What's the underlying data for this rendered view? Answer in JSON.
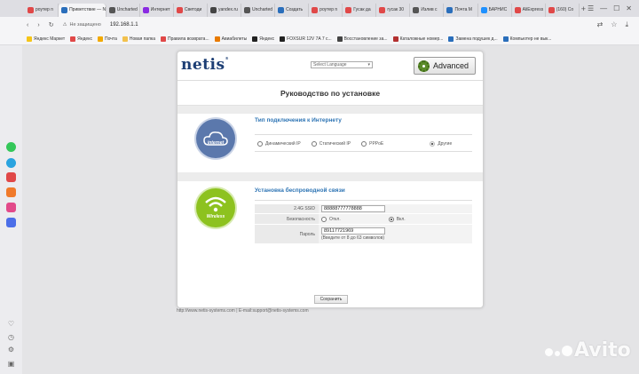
{
  "browser": {
    "tabs": [
      {
        "label": "роутер n",
        "color": "#e04848"
      },
      {
        "label": "Приветствие — N",
        "color": "#2a6ebb",
        "active": true
      },
      {
        "label": "Uncharted",
        "color": "#555555"
      },
      {
        "label": "Интернет",
        "color": "#8a2be2"
      },
      {
        "label": "Светоди",
        "color": "#e04848"
      },
      {
        "label": "yandex.ru",
        "color": "#444444"
      },
      {
        "label": "Uncharted",
        "color": "#555555"
      },
      {
        "label": "Создать",
        "color": "#2a6ebb"
      },
      {
        "label": "роутер n",
        "color": "#e04848"
      },
      {
        "label": "Гусак да",
        "color": "#e04848"
      },
      {
        "label": "гусак 30",
        "color": "#e04848"
      },
      {
        "label": "Излив с",
        "color": "#555555"
      },
      {
        "label": "Почта M",
        "color": "#2a6ebb"
      },
      {
        "label": "БАРНИС",
        "color": "#1e90ff"
      },
      {
        "label": "AliExpress",
        "color": "#e04848"
      },
      {
        "label": "(160) Co",
        "color": "#e04848"
      }
    ],
    "new_tab": "+",
    "address": {
      "security_text": "Не защищено",
      "url": "192.168.1.1"
    },
    "bookmarks": [
      {
        "label": "Яндекс Маркет",
        "color": "#f5c518"
      },
      {
        "label": "Яндекс",
        "color": "#e04848"
      },
      {
        "label": "Почта",
        "color": "#f2a900"
      },
      {
        "label": "Новая папка",
        "color": "#f2c14e"
      },
      {
        "label": "Правила возврата...",
        "color": "#e04848"
      },
      {
        "label": "Авиабилеты",
        "color": "#e87a00"
      },
      {
        "label": "Яндекс",
        "color": "#222222"
      },
      {
        "label": "FOXSUR 12V 7A 7 с...",
        "color": "#222222"
      },
      {
        "label": "Восстановление за...",
        "color": "#444444"
      },
      {
        "label": "Каталожные номер...",
        "color": "#b33030"
      },
      {
        "label": "Замена подушек д...",
        "color": "#2a6ebb"
      },
      {
        "label": "Компьютер не вык...",
        "color": "#2a6ebb"
      }
    ]
  },
  "router": {
    "logo": "netis",
    "language_select": "Select Language",
    "advanced_button": "Advanced",
    "page_title": "Руководство по установке",
    "connection": {
      "title": "Тип подключения к Интернету",
      "icon_label": "internet",
      "options": [
        {
          "label": "Динамический IP",
          "selected": false,
          "disabled": false
        },
        {
          "label": "Статический IP",
          "selected": false,
          "disabled": false
        },
        {
          "label": "PPPoE",
          "selected": false,
          "disabled": false
        },
        {
          "label": "Другие",
          "selected": true,
          "disabled": true
        }
      ]
    },
    "wireless": {
      "title": "Установка беспроводной связи",
      "icon_label": "Wireless",
      "ssid_label": "2.4G SSID",
      "ssid_value": "88888777778888",
      "security_label": "Безопасность",
      "security_off": "Откл.",
      "security_on": "Вкл.",
      "password_label": "Пароль",
      "password_value": "89117721969",
      "password_hint": "(Введите от 8 до 63 символов)"
    },
    "save_button": "Сохранить",
    "footer": "http://www.netis-systems.com | E-mail:support@netis-systems.com"
  },
  "watermark": "Avito"
}
